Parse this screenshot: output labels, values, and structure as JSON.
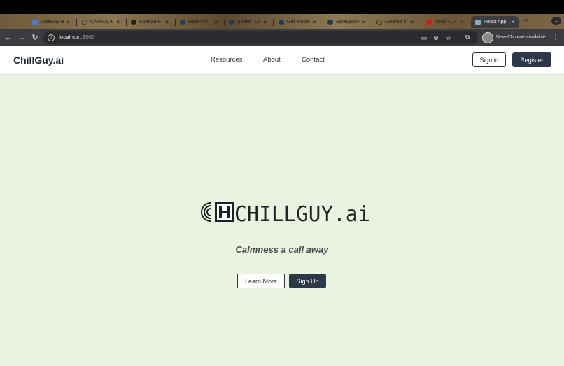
{
  "browser": {
    "tabs": [
      {
        "label": "ChillGuy H",
        "favicon": "doc-icon",
        "color": "#4a7bd6"
      },
      {
        "label": "ChillGuy.ai",
        "favicon": "globe-icon",
        "color": "#6b6b6b"
      },
      {
        "label": "Spartan-F",
        "favicon": "github-icon",
        "color": "#222222"
      },
      {
        "label": "Hack For",
        "favicon": "devpost-icon",
        "color": "#1f3b56"
      },
      {
        "label": "Speks | De",
        "favicon": "devpost-icon",
        "color": "#1f3b56"
      },
      {
        "label": "Get Waste",
        "favicon": "devpost-icon",
        "color": "#1f3b56"
      },
      {
        "label": "SafeSpace",
        "favicon": "devpost-icon",
        "color": "#1f3b56"
      },
      {
        "label": "Colored b",
        "favicon": "openai-icon",
        "color": "#333333"
      },
      {
        "label": "Inbox (1,7",
        "favicon": "gmail-icon",
        "color": "#c5221f"
      },
      {
        "label": "React App",
        "favicon": "react-icon",
        "color": "#61dafb"
      }
    ],
    "url_host": "localhost",
    "url_port": ":3000",
    "update_chip": "New Chrome available"
  },
  "nav": {
    "brand": "ChillGuy.ai",
    "links": [
      "Resources",
      "About",
      "Contact"
    ],
    "signin": "Sign in",
    "register": "Register"
  },
  "hero": {
    "logo_text": "CHILLGUY.ai",
    "tagline": "Calmness a call away",
    "learn_more": "Learn More",
    "sign_up": "Sign Up"
  },
  "colors": {
    "accent": "#2c3848",
    "background": "#e9f3e0"
  }
}
